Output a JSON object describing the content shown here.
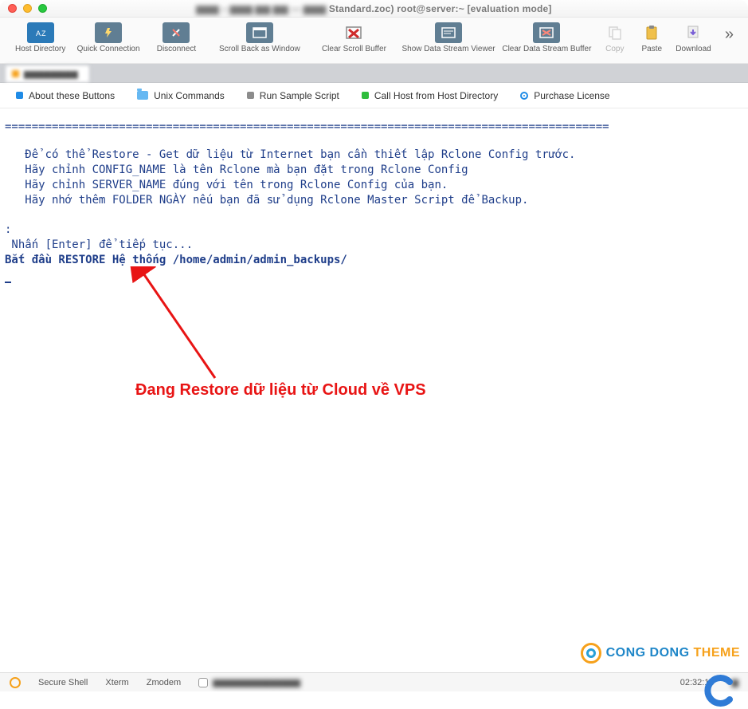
{
  "window": {
    "title_suffix": "Standard.zoc) root@server:~ [evaluation mode]"
  },
  "toolbar": [
    {
      "label": "Host Directory"
    },
    {
      "label": "Quick Connection"
    },
    {
      "label": "Disconnect"
    },
    {
      "label": "Scroll Back as Window"
    },
    {
      "label": "Clear Scroll Buffer"
    },
    {
      "label": "Show Data Stream Viewer"
    },
    {
      "label": "Clear Data Stream Buffer"
    },
    {
      "label": "Copy"
    },
    {
      "label": "Paste"
    },
    {
      "label": "Download"
    }
  ],
  "buttonbar": {
    "about": "About these Buttons",
    "unix": "Unix Commands",
    "run": "Run Sample Script",
    "call": "Call Host from Host Directory",
    "purchase": "Purchase License"
  },
  "terminal": {
    "eq": "==========================================================================================",
    "l1": "   Để có thể Restore - Get dữ liệu từ Internet bạn cần thiết lập Rclone Config trước.",
    "l2": "   Hãy chỉnh CONFIG_NAME là tên Rclone mà bạn đặt trong Rclone Config",
    "l3": "   Hãy chỉnh SERVER_NAME đúng với tên trong Rclone Config của bạn.",
    "l4": "   Hãy nhớ thêm FOLDER NGÀY nếu bạn đã sử dụng Rclone Master Script để Backup.",
    "l5": ":",
    "l6": " Nhấn [Enter] để tiếp tục...",
    "l7": "Bắt đầu RESTORE Hệ thống /home/admin/admin_backups/"
  },
  "annotation": "Đang Restore dữ liệu từ Cloud về VPS",
  "watermark": {
    "part1": "CONG DONG",
    "part2": "THEME"
  },
  "status": {
    "secure": "Secure Shell",
    "xterm": "Xterm",
    "zmodem": "Zmodem",
    "time": "02:32:18"
  }
}
